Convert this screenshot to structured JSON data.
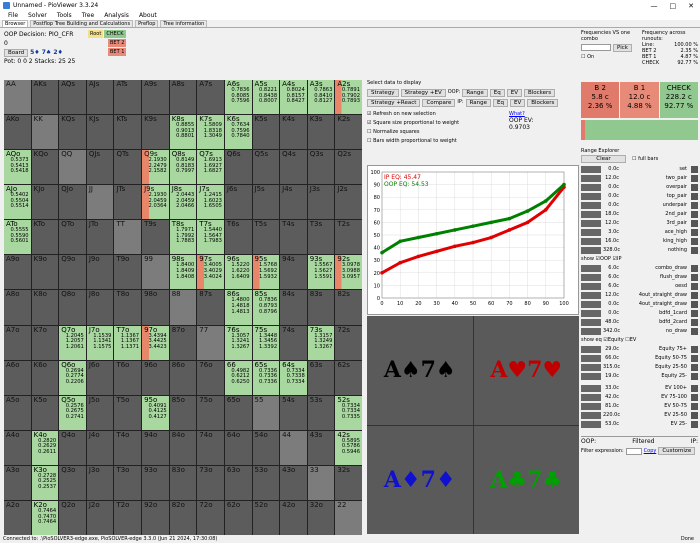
{
  "window": {
    "title": "Unnamed - PioViewer 3.3.24",
    "min": "—",
    "max": "□",
    "close": "✕"
  },
  "menu": [
    "File",
    "Solver",
    "Tools",
    "Tree",
    "Analysis",
    "About"
  ],
  "tabs": [
    "Browser",
    "Postflop Tree Building and Calculations",
    "Preflop",
    "Tree information"
  ],
  "topleft": {
    "decision": "OOP Decision:  PIO_CFR",
    "zero": "0",
    "board_btn": "Board",
    "board": "5♦ 7♠ 2♦",
    "pot": "Pot: 0 0 2 Stacks: 25 25"
  },
  "tree": {
    "root": "Root",
    "check": "CHECK",
    "bet2": "BET 2",
    "bet1": "BET 1"
  },
  "grid": [
    [
      "AA",
      "AKs",
      "AQs",
      "AJs",
      "ATs",
      "A9s",
      "A8s",
      "A7s",
      "A6s",
      "A5s",
      "A4s",
      "A3s",
      "A2s"
    ],
    [
      "AKo",
      "KK",
      "KQs",
      "KJs",
      "KTs",
      "K9s",
      "K8s",
      "K7s",
      "K6s",
      "K5s",
      "K4s",
      "K3s",
      "K2s"
    ],
    [
      "AQo",
      "KQo",
      "QQ",
      "QJs",
      "QTs",
      "Q9s",
      "Q8s",
      "Q7s",
      "Q6s",
      "Q5s",
      "Q4s",
      "Q3s",
      "Q2s"
    ],
    [
      "AJo",
      "KJo",
      "QJo",
      "JJ",
      "JTs",
      "J9s",
      "J8s",
      "J7s",
      "J6s",
      "J5s",
      "J4s",
      "J3s",
      "J2s"
    ],
    [
      "ATo",
      "KTo",
      "QTo",
      "JTo",
      "TT",
      "T9s",
      "T8s",
      "T7s",
      "T6s",
      "T5s",
      "T4s",
      "T3s",
      "T2s"
    ],
    [
      "A9o",
      "K9o",
      "Q9o",
      "J9o",
      "T9o",
      "99",
      "98s",
      "97s",
      "96s",
      "95s",
      "94s",
      "93s",
      "92s"
    ],
    [
      "A8o",
      "K8o",
      "Q8o",
      "J8o",
      "T8o",
      "98o",
      "88",
      "87s",
      "86s",
      "85s",
      "84s",
      "83s",
      "82s"
    ],
    [
      "A7o",
      "K7o",
      "Q7o",
      "J7o",
      "T7o",
      "97o",
      "87o",
      "77",
      "76s",
      "75s",
      "74s",
      "73s",
      "72s"
    ],
    [
      "A6o",
      "K6o",
      "Q6o",
      "J6o",
      "T6o",
      "96o",
      "86o",
      "76o",
      "66",
      "65s",
      "64s",
      "63s",
      "62s"
    ],
    [
      "A5o",
      "K5o",
      "Q5o",
      "J5o",
      "T5o",
      "95o",
      "85o",
      "75o",
      "65o",
      "55",
      "54s",
      "53s",
      "52s"
    ],
    [
      "A4o",
      "K4o",
      "Q4o",
      "J4o",
      "T4o",
      "94o",
      "84o",
      "74o",
      "64o",
      "54o",
      "44",
      "43s",
      "42s"
    ],
    [
      "A3o",
      "K3o",
      "Q3o",
      "J3o",
      "T3o",
      "93o",
      "83o",
      "73o",
      "63o",
      "53o",
      "43o",
      "33",
      "32s"
    ],
    [
      "A2o",
      "K2o",
      "Q2o",
      "J2o",
      "T2o",
      "92o",
      "82o",
      "72o",
      "62o",
      "52o",
      "42o",
      "32o",
      "22"
    ]
  ],
  "cellnums": {
    "A6s": [
      "0.7836",
      "0.8085",
      "0.7596"
    ],
    "A5s": [
      "0.8221",
      "0.8438",
      "0.8007"
    ],
    "A4s": [
      "0.8024",
      "0.8157",
      "0.8427"
    ],
    "A3s": [
      "0.7863",
      "0.8410",
      "0.8127"
    ],
    "A2s": [
      "0.7891",
      "0.7902",
      "0.7893"
    ],
    "K8s": [
      "0.8855",
      "0.9013",
      "0.8801"
    ],
    "K7s": [
      "1.5809",
      "1.8318",
      "1.3049"
    ],
    "K6s": [
      "0.7634",
      "0.7596",
      "0.7840"
    ],
    "AQo": [
      "0.5373",
      "0.5413",
      "0.5418"
    ],
    "Q9s": [
      "2.1930",
      "2.2479",
      "2.1582"
    ],
    "Q8s": [
      "0.8149",
      "0.8183",
      "0.7997"
    ],
    "Q7s": [
      "1.6913",
      "1.6927",
      "1.6827"
    ],
    "AJo": [
      "0.5402",
      "0.5504",
      "0.5514"
    ],
    "J9s": [
      "2.1930",
      "2.0459",
      "2.0364"
    ],
    "J8s": [
      "2.0443",
      "2.0459",
      "2.0466"
    ],
    "J7s": [
      "1.2415",
      "1.6023",
      "1.6505"
    ],
    "ATo": [
      "0.5555",
      "0.5590",
      "0.5601"
    ],
    "T8s": [
      "1.7971",
      "1.7992",
      "1.7883"
    ],
    "T7s": [
      "1.5440",
      "1.5647",
      "1.7983"
    ],
    "98s": [
      "1.8400",
      "1.8409",
      "1.8408"
    ],
    "97s": [
      "3.4005",
      "3.4029",
      "3.4024"
    ],
    "96s": [
      "1.5220",
      "1.6220",
      "1.6409"
    ],
    "95s": [
      "1.5768",
      "1.5692",
      "1.5932"
    ],
    "93s": [
      "1.5567",
      "1.5627",
      "1.5591"
    ],
    "92s": [
      "3.0978",
      "3.0988",
      "3.0957"
    ],
    "86s": [
      "1.4800",
      "1.4818",
      "1.4813"
    ],
    "85s": [
      "0.7836",
      "0.8793",
      "0.8796"
    ],
    "Q7o": [
      "1.2045",
      "1.2057",
      "1.2061"
    ],
    "J7o": [
      "1.1539",
      "1.1341",
      "1.1575"
    ],
    "T7o": [
      "1.1367",
      "1.1367",
      "1.1371"
    ],
    "97o": [
      "3.4394",
      "3.4425",
      "3.4423"
    ],
    "76s": [
      "1.3057",
      "1.3241",
      "1.3267"
    ],
    "75s": [
      "1.3448",
      "1.3456",
      "1.3392"
    ],
    "73s": [
      "1.3157",
      "1.3249",
      "1.3267"
    ],
    "Q6o": [
      "0.2694",
      "0.2774",
      "0.2206"
    ],
    "66": [
      "0.4982",
      "0.6212",
      "0.6250"
    ],
    "65s": [
      "0.7336",
      "0.7336",
      "0.7336"
    ],
    "64s": [
      "0.7334",
      "0.7338",
      "0.7334"
    ],
    "Q5o": [
      "0.2576",
      "0.2675",
      "0.2741"
    ],
    "95o": [
      "0.4091",
      "0.4125",
      "0.4127"
    ],
    "52s": [
      "0.7334",
      "0.7334",
      "0.7335"
    ],
    "K4o": [
      "0.2820",
      "0.2629",
      "0.2611"
    ],
    "42s": [
      "0.5895",
      "0.5786",
      "0.5946"
    ],
    "K3o": [
      "0.2728",
      "0.2525",
      "0.2537"
    ],
    "K2o": [
      "0.7464",
      "0.7470",
      "0.7464"
    ]
  },
  "selcells": [
    "A6s",
    "A5s",
    "A4s",
    "A3s",
    "A2s",
    "K8s",
    "K7s",
    "K6s",
    "AQo",
    "Q8s",
    "Q7s",
    "AJo",
    "J8s",
    "J7s",
    "ATo",
    "T8s",
    "T7s",
    "98s",
    "97s",
    "96s",
    "95s",
    "93s",
    "92s",
    "86s",
    "85s",
    "Q7o",
    "J7o",
    "T7o",
    "97o",
    "76s",
    "75s",
    "73s",
    "Q6o",
    "66",
    "65s",
    "64s",
    "Q5o",
    "95o",
    "52s",
    "K4o",
    "42s",
    "K3o",
    "K2o"
  ],
  "redcells": [
    "Q9s",
    "J9s",
    "97s",
    "97o",
    "95s",
    "92s",
    "A2s"
  ],
  "middle": {
    "select": "Select data to display",
    "btns1": [
      "Strategy",
      "Strategy +EV",
      "OOP:",
      "Range",
      "Eq",
      "EV",
      "Blockers"
    ],
    "btns2": [
      "Strategy +React",
      "Compare",
      "IP:",
      "Range",
      "Eq",
      "EV",
      "Blockers"
    ],
    "chk": [
      "Refresh on new selection",
      "Square size proportional to weight",
      "Normalize squares",
      "Bars width proportional to weight"
    ],
    "what": "What?",
    "oopev_label": "OOP EV:",
    "oopev": "0.9703"
  },
  "chart_data": {
    "type": "line",
    "series": [
      {
        "name": "IP EQ: 45.47",
        "color": "#e00000"
      },
      {
        "name": "OOP EQ: 54.53",
        "color": "#008000"
      }
    ],
    "xlim": [
      0,
      100
    ],
    "ylim": [
      0,
      100
    ],
    "xticks": [
      0,
      10,
      20,
      30,
      40,
      50,
      60,
      70,
      80,
      90,
      100
    ],
    "yticks": [
      0,
      10,
      20,
      30,
      40,
      50,
      60,
      70,
      80,
      90,
      100
    ],
    "x": [
      0,
      10,
      20,
      30,
      40,
      50,
      60,
      70,
      80,
      90,
      100
    ],
    "ip": [
      20,
      28,
      33,
      37,
      41,
      44,
      48,
      54,
      60,
      70,
      88
    ],
    "oop": [
      36,
      45,
      48,
      51,
      54,
      57,
      60,
      63,
      69,
      77,
      90
    ]
  },
  "cards": [
    {
      "rank": "A",
      "suit": "♠",
      "color": "#000"
    },
    {
      "rank": "A",
      "suit": "♥",
      "color": "#c00000"
    },
    {
      "rank": "A",
      "suit": "♦",
      "color": "#1010d0"
    },
    {
      "rank": "A",
      "suit": "♣",
      "color": "#00a000"
    }
  ],
  "cardsuffix": [
    {
      "r": "7",
      "s": "♠"
    },
    {
      "r": "7",
      "s": "♥"
    },
    {
      "r": "7",
      "s": "♦"
    },
    {
      "r": "7",
      "s": "♣"
    }
  ],
  "right": {
    "freqvs": "Frequencies VS one combo",
    "pick": "Pick",
    "on": "On",
    "runouts": "Frequency across runouts:",
    "line": "Line:",
    "line_v": "100.00 %",
    "bet2": "BET 2",
    "bet2_v": "2.35 %",
    "bet1": "BET 1",
    "bet1_v": "4.87 %",
    "check": "CHECK",
    "check_v": "92.77 %"
  },
  "freq": [
    {
      "name": "B 2",
      "ev": "5.8 c",
      "pct": "2.36 %",
      "color": "#e07a6a"
    },
    {
      "name": "B 1",
      "ev": "12.0 c",
      "pct": "4.88 %",
      "color": "#e88a78"
    },
    {
      "name": "CHECK",
      "ev": "228.2 c",
      "pct": "92.77 %",
      "color": "#90c890"
    }
  ],
  "rangeexp": {
    "title": "Range Explorer",
    "clear": "Clear",
    "fullbars": "full bars",
    "rows1": [
      [
        "0.0c",
        "set"
      ],
      [
        "12.0c",
        "two_pair"
      ],
      [
        "0.0c",
        "overpair"
      ],
      [
        "0.0c",
        "top_pair"
      ],
      [
        "0.0c",
        "underpair"
      ],
      [
        "18.0c",
        "2nd_pair"
      ],
      [
        "12.0c",
        "3rd_pair"
      ],
      [
        "3.0c",
        "ace_high"
      ],
      [
        "16.0c",
        "king_high"
      ],
      [
        "328.0c",
        "nothing"
      ]
    ],
    "show": "show",
    "oop": "OOP",
    "ip": "IP",
    "rows2": [
      [
        "6.0c",
        "combo_draw"
      ],
      [
        "6.0c",
        "flush_draw"
      ],
      [
        "6.0c",
        "oesd"
      ],
      [
        "12.0c",
        "4out_straight_draw"
      ],
      [
        "0.0c",
        "4out_straight_draw"
      ],
      [
        "0.0c",
        "bdfd_1card"
      ],
      [
        "48.0c",
        "bdfd_2card"
      ],
      [
        "342.0c",
        "no_draw"
      ]
    ],
    "showeq": "show eq",
    "equity": "Equity",
    "ev": "EV",
    "rows3": [
      [
        "29.0c",
        "Equity 75+"
      ],
      [
        "66.0c",
        "Equity 50-75"
      ],
      [
        "315.0c",
        "Equity 25-50"
      ],
      [
        "19.0c",
        "Equity 25-"
      ]
    ],
    "rows4": [
      [
        "33.0c",
        "EV 100+"
      ],
      [
        "42.0c",
        "EV 75-100"
      ],
      [
        "81.0c",
        "EV 50-75"
      ],
      [
        "220.0c",
        "EV 25-50"
      ],
      [
        "53.0c",
        "EV 25-"
      ]
    ],
    "filter": "Filtered",
    "oopc": "OOP:",
    "ipc": "IP:",
    "fexpr": "Filter expression:",
    "copy": "Copy",
    "customize": "Customize"
  },
  "status": "Connected to: .\\PioSOLVER3-edge.exe, PioSOLVER-edge 3.3.0 (Jun 21 2024, 17:30:08)",
  "done": "Done"
}
